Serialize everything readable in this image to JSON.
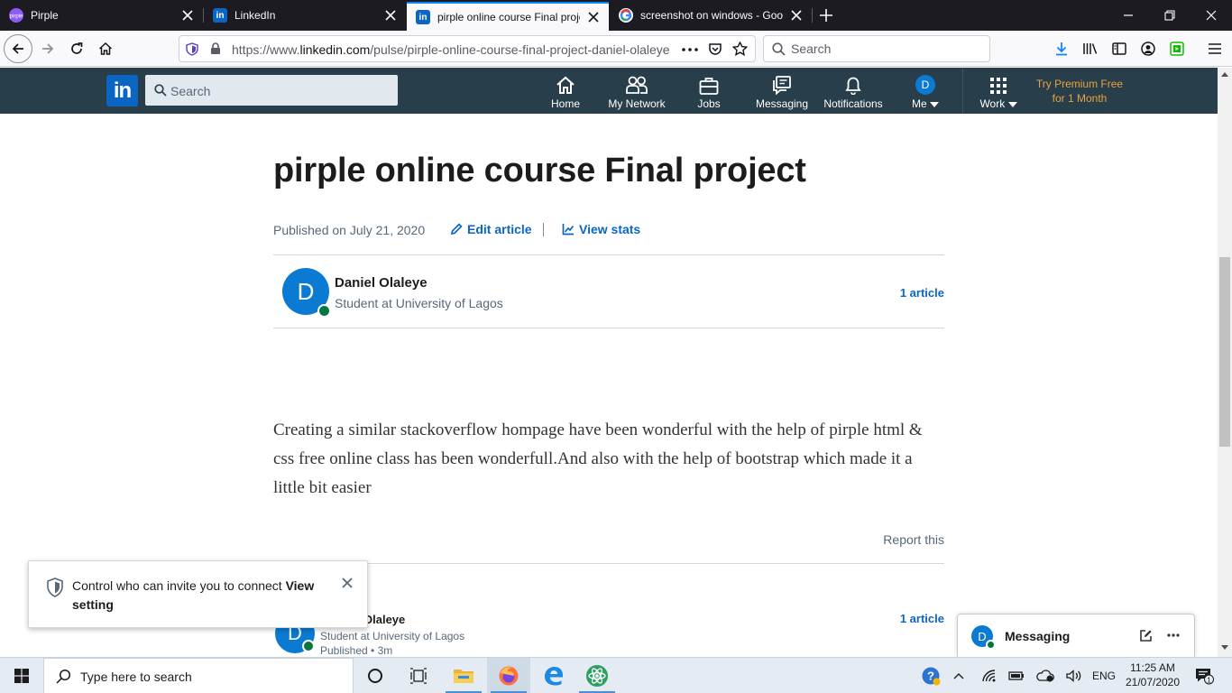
{
  "browser": {
    "tabs": [
      {
        "title": "Pirple",
        "favicon": "pirple-icon",
        "active": false
      },
      {
        "title": "LinkedIn",
        "favicon": "linkedin-icon",
        "active": false
      },
      {
        "title": "pirple online course Final proje",
        "favicon": "linkedin-icon",
        "active": true
      },
      {
        "title": "screenshot on windows - Goog",
        "favicon": "google-icon",
        "active": false
      }
    ],
    "url_prefix": "https://www.",
    "url_domain": "linkedin.com",
    "url_path": "/pulse/pirple-online-course-final-project-daniel-olaleye",
    "search_placeholder": "Search"
  },
  "linkedin": {
    "logo_text": "in",
    "search_placeholder": "Search",
    "nav": [
      {
        "label": "Home",
        "icon": "home-icon"
      },
      {
        "label": "My Network",
        "icon": "network-icon"
      },
      {
        "label": "Jobs",
        "icon": "briefcase-icon"
      },
      {
        "label": "Messaging",
        "icon": "messaging-icon"
      },
      {
        "label": "Notifications",
        "icon": "bell-icon"
      },
      {
        "label": "Me",
        "icon": "avatar",
        "avatar_letter": "D"
      },
      {
        "label": "Work",
        "icon": "grid-icon"
      }
    ],
    "premium_line1": "Try Premium Free",
    "premium_line2": "for 1 Month",
    "brand_color": "#0a66c2",
    "header_color": "#283e4a"
  },
  "article": {
    "title": "pirple online course Final project",
    "published": "Published on July 21, 2020",
    "edit_label": "Edit article",
    "stats_label": "View stats",
    "author": {
      "initial": "D",
      "name": "Daniel Olaleye",
      "headline": "Student at University of Lagos",
      "articles": "1 article"
    },
    "body": "Creating a similar stackoverflow hompage have been wonderful with the help of pirple html & css free online class has been wonderfull.And also with the help of bootstrap which made it a little bit easier",
    "report_label": "Report this",
    "footer_author": {
      "initial": "D",
      "name_visible": "Olaleye",
      "headline": "Student at University of Lagos",
      "published": "Published • 3m",
      "articles": "1 article"
    }
  },
  "toast": {
    "text": "Control who can invite you to connect ",
    "link": "View setting"
  },
  "messaging": {
    "initial": "D",
    "label": "Messaging"
  },
  "taskbar": {
    "search_placeholder": "Type here to search",
    "language": "ENG",
    "time": "11:25 AM",
    "date": "21/07/2020",
    "notification_count": "1"
  }
}
